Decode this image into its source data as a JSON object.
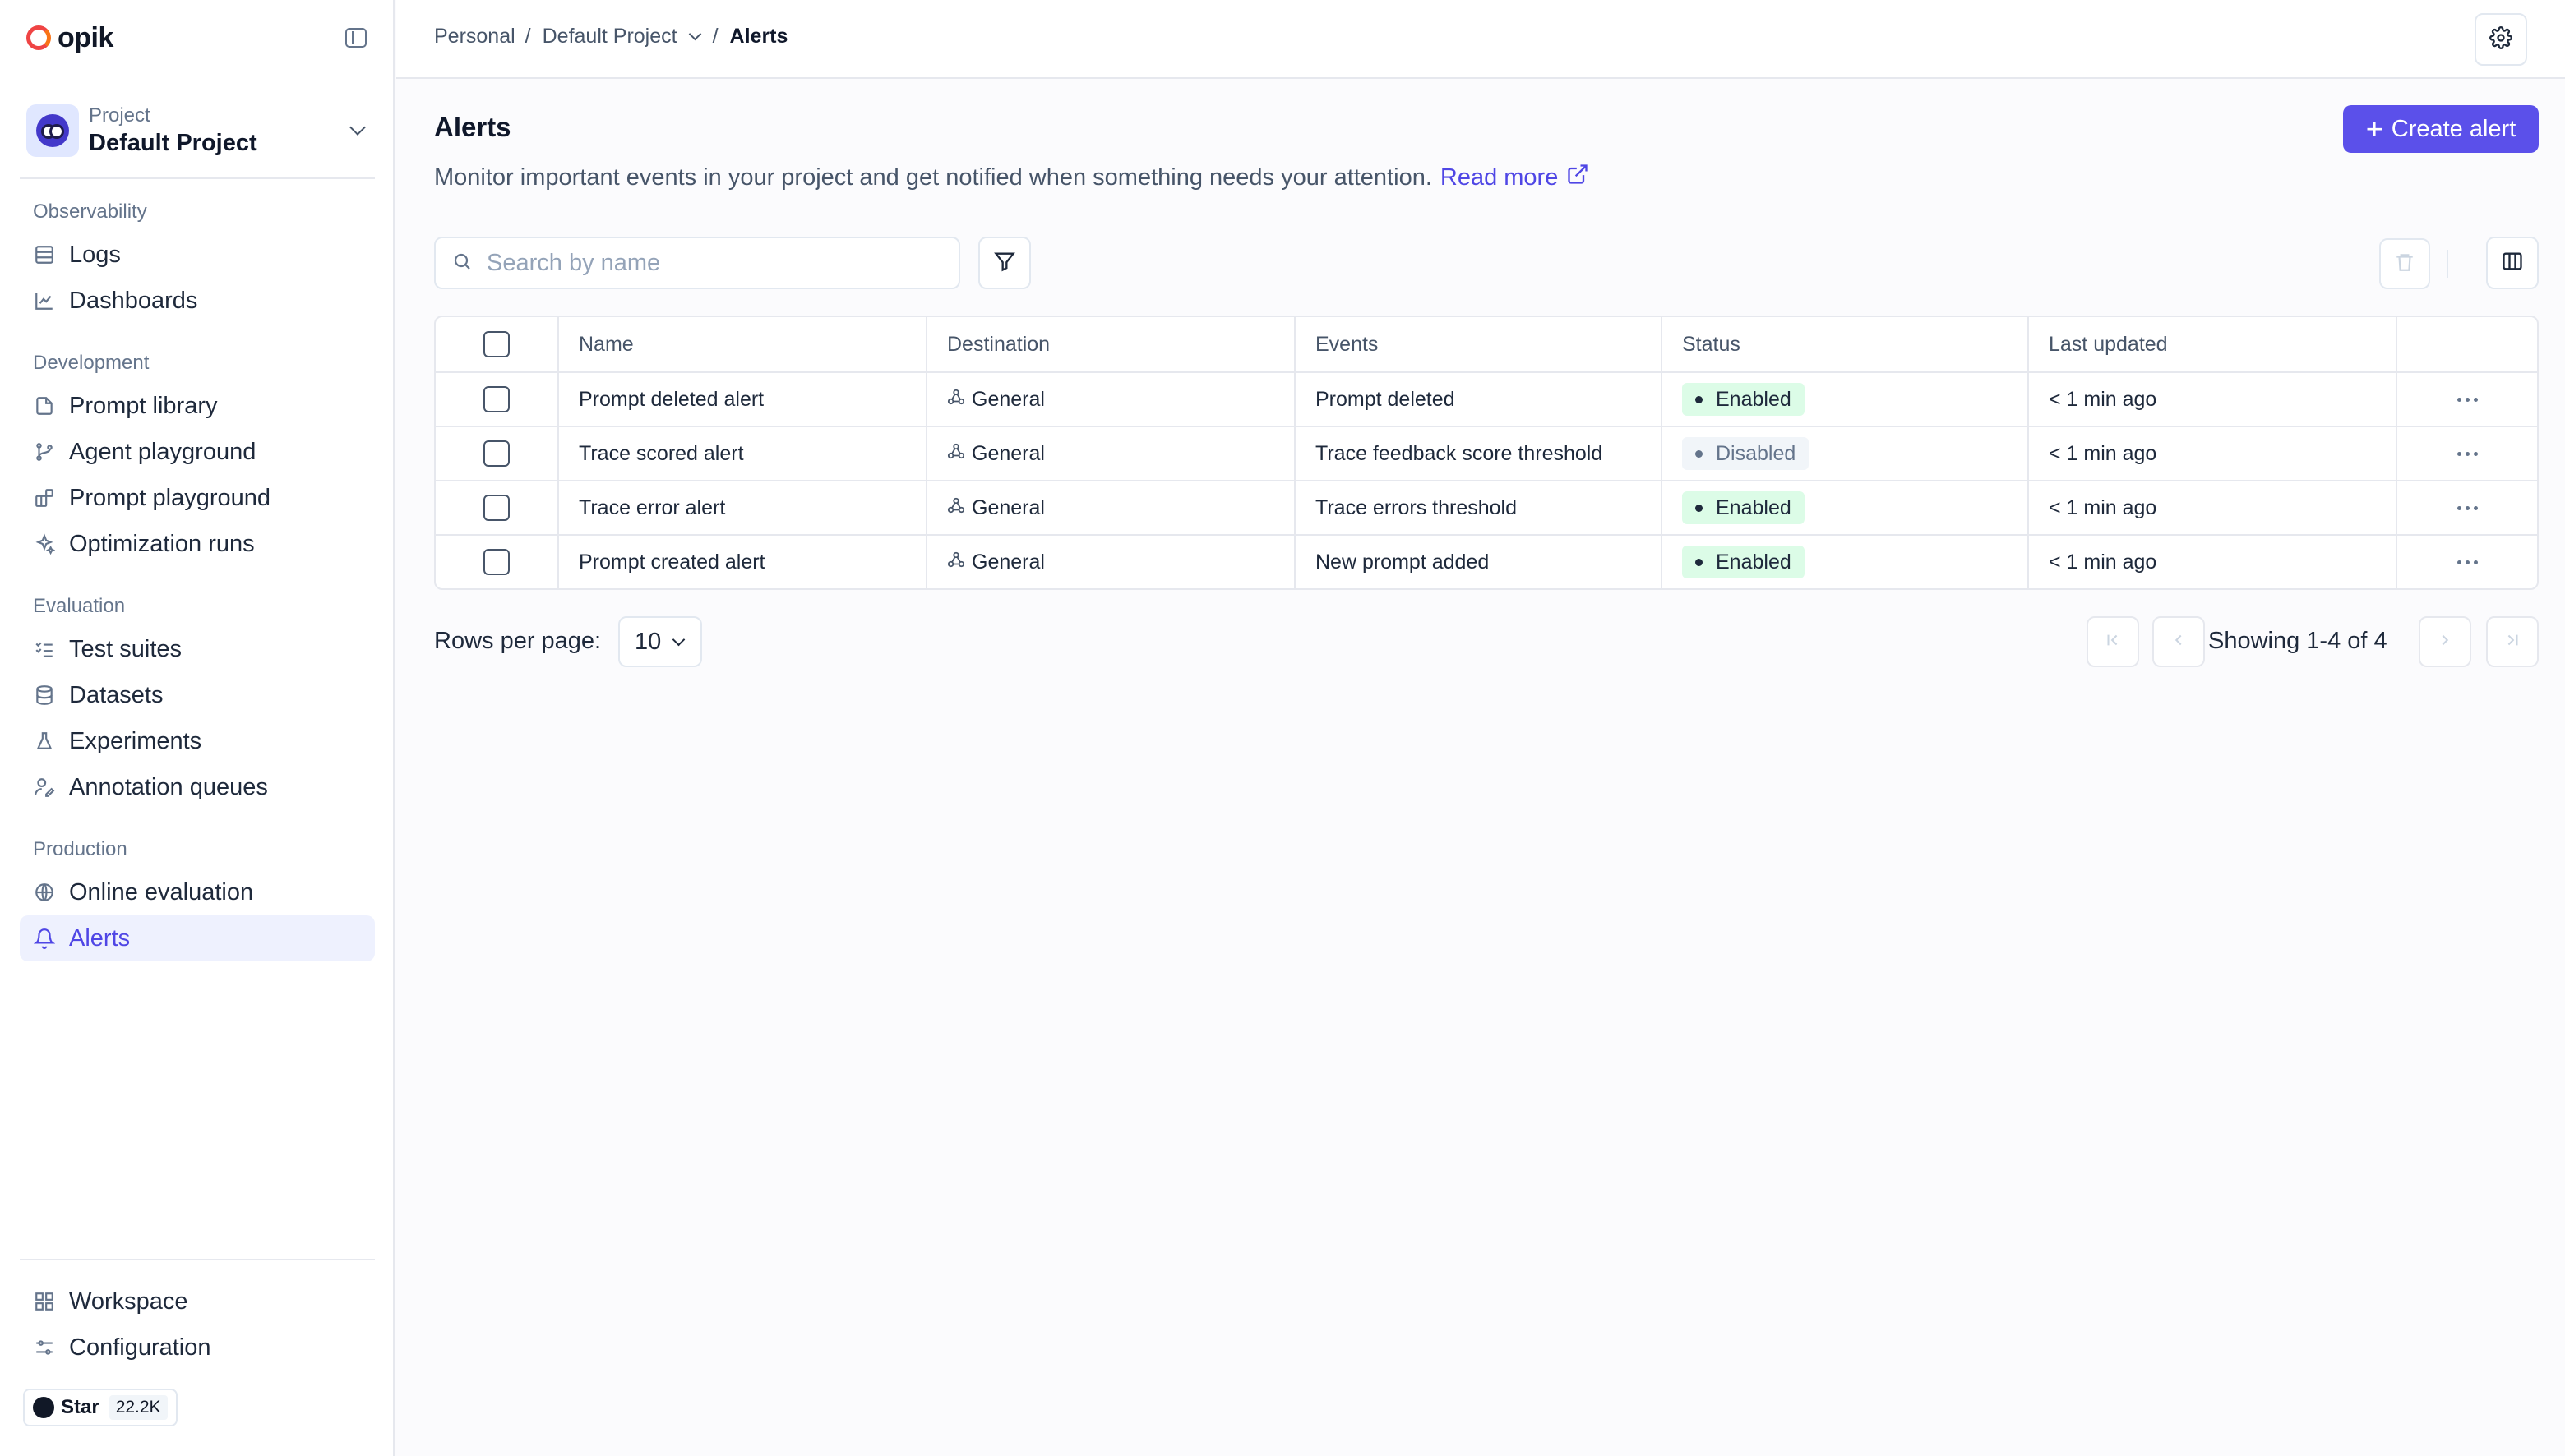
{
  "app": {
    "logo_text": "opik"
  },
  "sidebar": {
    "project": {
      "label": "Project",
      "name": "Default Project"
    },
    "sections": [
      {
        "title": "Observability",
        "items": [
          {
            "label": "Logs",
            "icon": "logs-icon"
          },
          {
            "label": "Dashboards",
            "icon": "chart-icon"
          }
        ]
      },
      {
        "title": "Development",
        "items": [
          {
            "label": "Prompt library",
            "icon": "file-icon"
          },
          {
            "label": "Agent playground",
            "icon": "branch-icon"
          },
          {
            "label": "Prompt playground",
            "icon": "blocks-icon"
          },
          {
            "label": "Optimization runs",
            "icon": "sparkles-icon"
          }
        ]
      },
      {
        "title": "Evaluation",
        "items": [
          {
            "label": "Test suites",
            "icon": "checklist-icon"
          },
          {
            "label": "Datasets",
            "icon": "database-icon"
          },
          {
            "label": "Experiments",
            "icon": "flask-icon"
          },
          {
            "label": "Annotation queues",
            "icon": "user-pen-icon"
          }
        ]
      },
      {
        "title": "Production",
        "items": [
          {
            "label": "Online evaluation",
            "icon": "globe-icon"
          },
          {
            "label": "Alerts",
            "icon": "bell-icon",
            "active": true
          }
        ]
      }
    ],
    "bottom": [
      {
        "label": "Workspace",
        "icon": "grid-icon"
      },
      {
        "label": "Configuration",
        "icon": "sliders-icon"
      }
    ],
    "github": {
      "label": "Star",
      "count": "22.2K"
    }
  },
  "topbar": {
    "breadcrumb": [
      "Personal",
      "Default Project",
      "Alerts"
    ]
  },
  "main": {
    "title": "Alerts",
    "description": "Monitor important events in your project and get notified when something needs your attention.",
    "read_more": "Read more",
    "create_button": "Create alert",
    "search": {
      "placeholder": "Search by name",
      "value": ""
    }
  },
  "table": {
    "columns": [
      "Name",
      "Destination",
      "Events",
      "Status",
      "Last updated"
    ],
    "rows": [
      {
        "name": "Prompt deleted alert",
        "destination": "General",
        "events": "Prompt deleted",
        "status": "Enabled",
        "updated": "< 1 min ago"
      },
      {
        "name": "Trace scored alert",
        "destination": "General",
        "events": "Trace feedback score threshold",
        "status": "Disabled",
        "updated": "< 1 min ago"
      },
      {
        "name": "Trace error alert",
        "destination": "General",
        "events": "Trace errors threshold",
        "status": "Enabled",
        "updated": "< 1 min ago"
      },
      {
        "name": "Prompt created alert",
        "destination": "General",
        "events": "New prompt added",
        "status": "Enabled",
        "updated": "< 1 min ago"
      }
    ]
  },
  "pagination": {
    "rows_label": "Rows per page:",
    "rows_per_page": "10",
    "status": "Showing 1-4 of 4"
  },
  "colors": {
    "accent": "#5b50ea",
    "enabled_bg": "#dcfce7",
    "disabled_bg": "#f1f5f9"
  }
}
